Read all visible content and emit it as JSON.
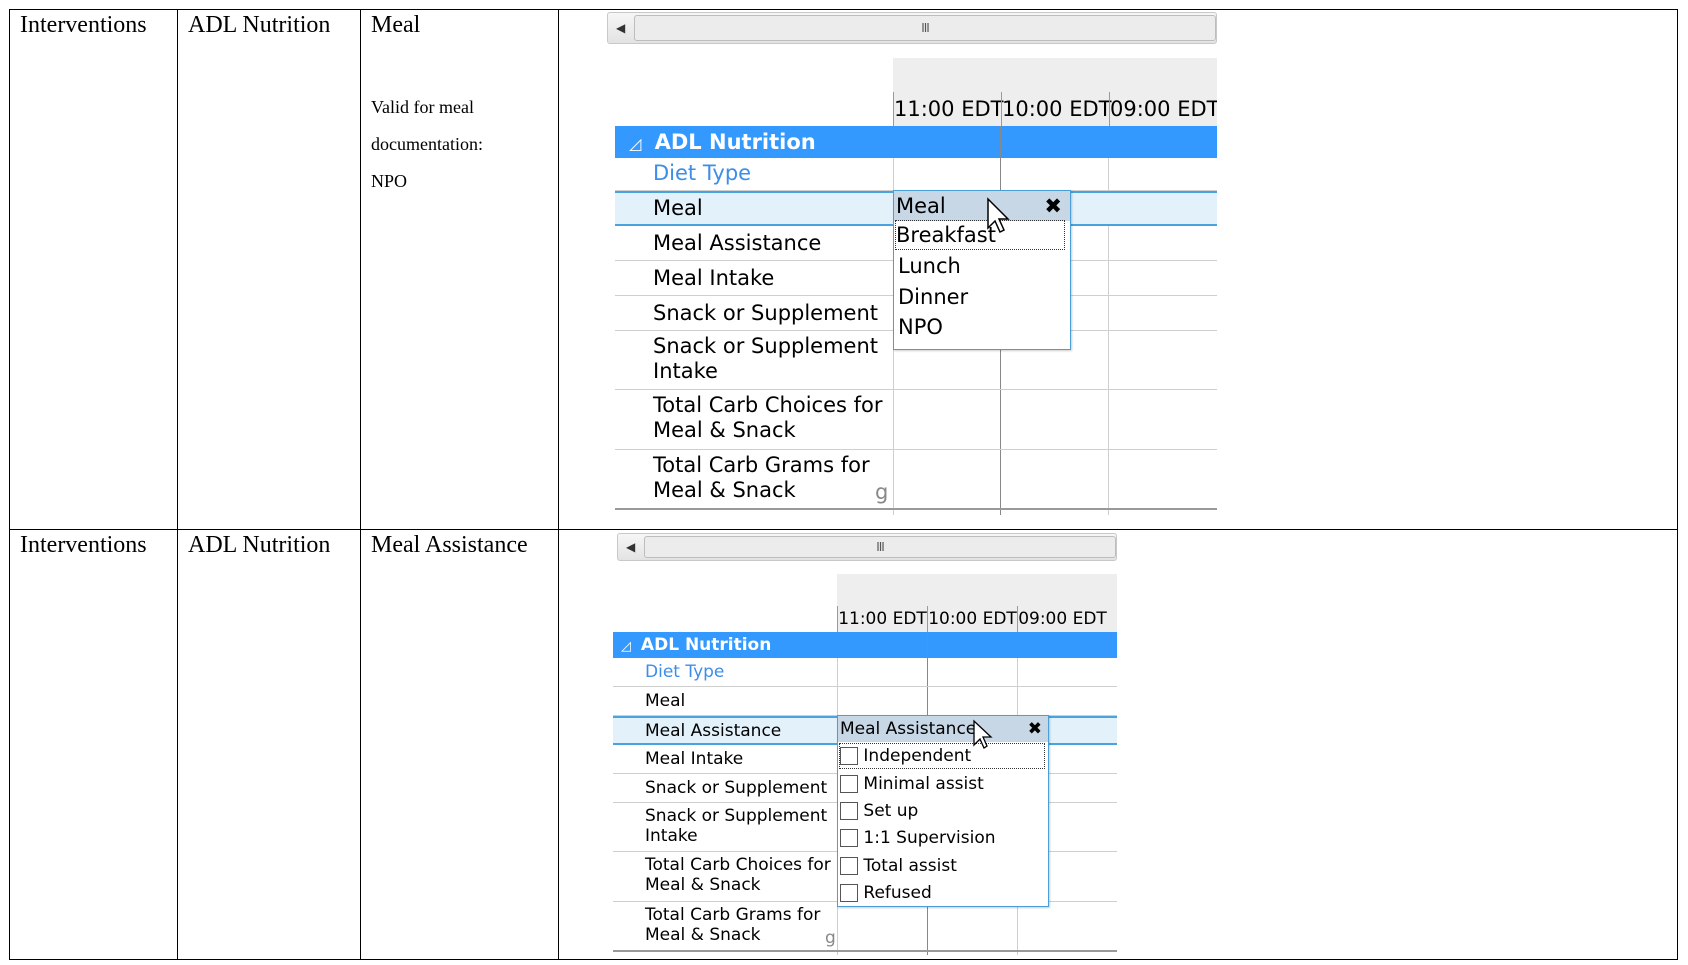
{
  "rows": [
    {
      "col1": "Interventions",
      "col2": "ADL Nutrition",
      "col3": "Meal",
      "note": [
        "Valid for meal",
        "documentation:",
        "NPO"
      ]
    },
    {
      "col1": "Interventions",
      "col2": "ADL Nutrition",
      "col3": "Meal Assistance"
    }
  ],
  "screenshot1": {
    "times": [
      "11:00 EDT",
      "10:00 EDT",
      "09:00 EDT"
    ],
    "section": "ADL Nutrition",
    "section_icon": "collapse-triangle-icon",
    "scroll_grip": "III",
    "items": [
      "Diet Type",
      "Meal",
      "Meal Assistance",
      "Meal Intake",
      "Snack or Supplement",
      "Snack or Supplement Intake",
      "Total Carb Choices for Meal & Snack",
      "Total Carb Grams for Meal & Snack"
    ],
    "unit": "g",
    "popup": {
      "title": "Meal",
      "close": "✖",
      "options": [
        "Breakfast",
        "Lunch",
        "Dinner",
        "NPO"
      ]
    }
  },
  "screenshot2": {
    "times": [
      "11:00 EDT",
      "10:00 EDT",
      "09:00 EDT"
    ],
    "section": "ADL Nutrition",
    "scroll_grip": "III",
    "items": [
      "Diet Type",
      "Meal",
      "Meal Assistance",
      "Meal Intake",
      "Snack or Supplement",
      "Snack or Supplement Intake",
      "Total Carb Choices for Meal & Snack",
      "Total Carb Grams for Meal & Snack"
    ],
    "unit": "g",
    "popup": {
      "title": "Meal Assistance",
      "close": "✖",
      "options": [
        "Independent",
        "Minimal assist",
        "Set up",
        "1:1 Supervision",
        "Total assist",
        "Refused"
      ]
    }
  },
  "colors": {
    "section_blue": "#3399ff",
    "link_blue": "#3d8ee8",
    "selected_row": "#e3f1fb",
    "popup_header": "#c8d7e6"
  }
}
